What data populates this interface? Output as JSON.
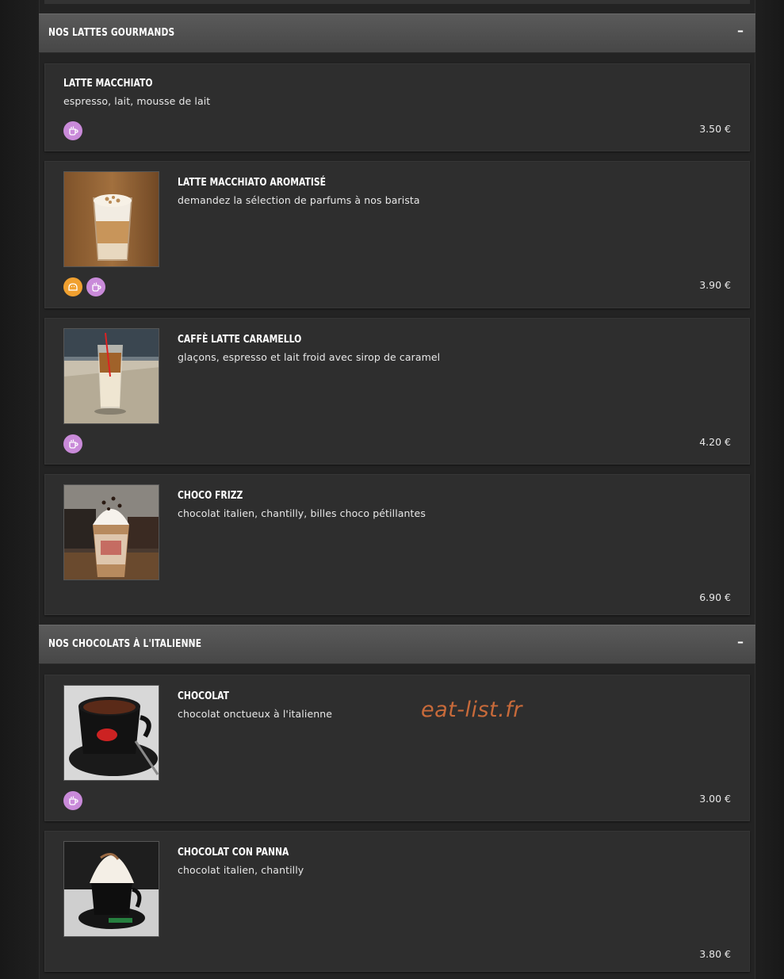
{
  "sections": [
    {
      "title": "Nos lattes gourmands",
      "toggle": "–",
      "items": [
        {
          "name": "Latte Macchiato",
          "description": "espresso, lait, mousse de lait",
          "price": "3.50 €",
          "badges": [
            "cup-icon"
          ]
        },
        {
          "name": "Latte Macchiato aromatisé",
          "description": "demandez la sélection de parfums à nos barista",
          "price": "3.90 €",
          "badges": [
            "bread-icon",
            "cup-icon"
          ]
        },
        {
          "name": "Caffè Latte Caramello",
          "description": "glaçons, espresso et lait froid avec sirop de caramel",
          "price": "4.20 €",
          "badges": [
            "cup-icon"
          ]
        },
        {
          "name": "Choco Frizz",
          "description": "chocolat italien, chantilly, billes choco pétillantes",
          "price": "6.90 €",
          "badges": []
        }
      ]
    },
    {
      "title": "Nos chocolats à l'italienne",
      "toggle": "–",
      "items": [
        {
          "name": "Chocolat",
          "description": "chocolat onctueux à l'italienne",
          "price": "3.00 €",
          "badges": [
            "cup-icon"
          ]
        },
        {
          "name": "Chocolat con panna",
          "description": "chocolat italien, chantilly",
          "price": "3.80 €",
          "badges": []
        }
      ]
    }
  ],
  "watermark": "eat-list.fr",
  "colors": {
    "badge_purple": "#c98ad9",
    "badge_orange": "#f0a030",
    "watermark": "#c86a3a",
    "header_bg": "#4f4f4f",
    "card_bg": "#2e2e2e"
  }
}
